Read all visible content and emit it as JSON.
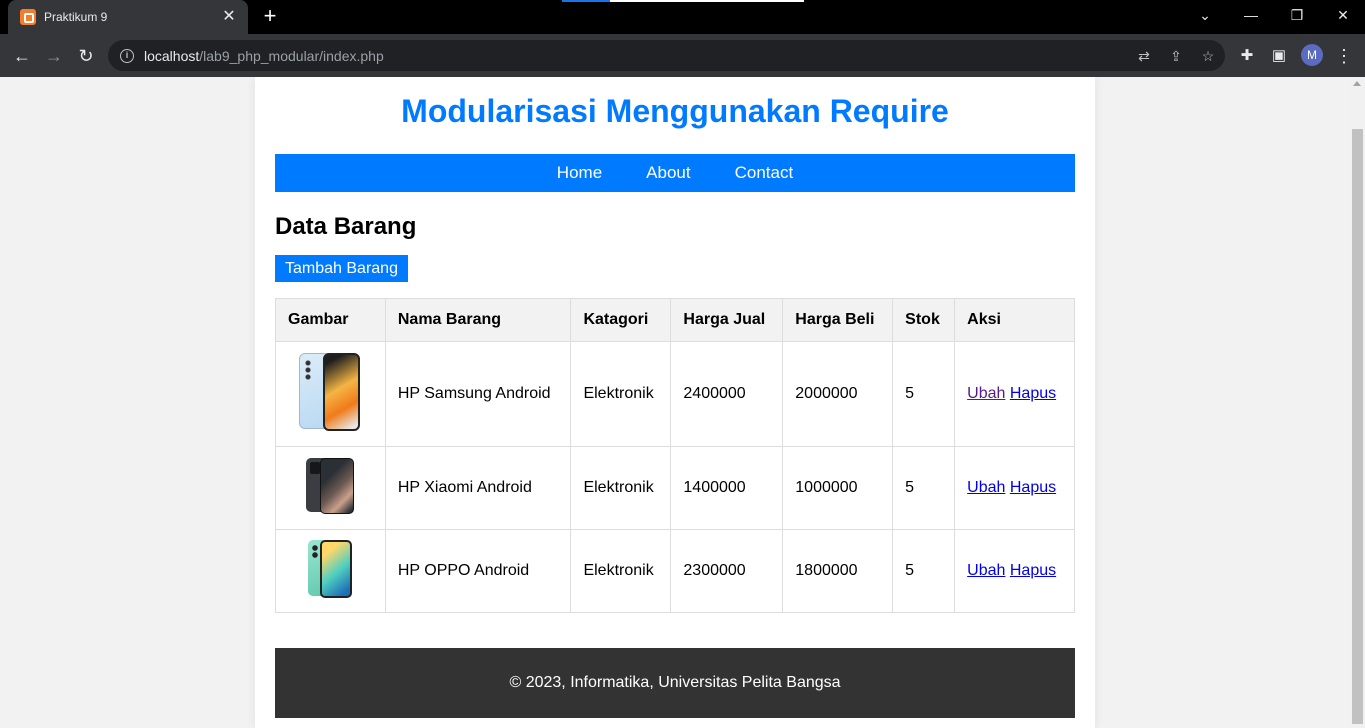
{
  "browser": {
    "tab_title": "Praktikum 9",
    "url_host": "localhost",
    "url_path": "/lab9_php_modular/index.php",
    "profile_initial": "M"
  },
  "page": {
    "title": "Modularisasi Menggunakan Require",
    "nav": [
      "Home",
      "About",
      "Contact"
    ],
    "section_title": "Data Barang",
    "add_button": "Tambah Barang",
    "table": {
      "headers": [
        "Gambar",
        "Nama Barang",
        "Katagori",
        "Harga Jual",
        "Harga Beli",
        "Stok",
        "Aksi"
      ],
      "rows": [
        {
          "image": "samsung-phone-image",
          "nama": "HP Samsung Android",
          "kategori": "Elektronik",
          "harga_jual": "2400000",
          "harga_beli": "2000000",
          "stok": "5",
          "ubah": "Ubah",
          "hapus": "Hapus"
        },
        {
          "image": "xiaomi-phone-image",
          "nama": "HP Xiaomi Android",
          "kategori": "Elektronik",
          "harga_jual": "1400000",
          "harga_beli": "1000000",
          "stok": "5",
          "ubah": "Ubah",
          "hapus": "Hapus"
        },
        {
          "image": "oppo-phone-image",
          "nama": "HP OPPO Android",
          "kategori": "Elektronik",
          "harga_jual": "2300000",
          "harga_beli": "1800000",
          "stok": "5",
          "ubah": "Ubah",
          "hapus": "Hapus"
        }
      ]
    },
    "footer": "© 2023, Informatika, Universitas Pelita Bangsa"
  },
  "colors": {
    "accent": "#007bff",
    "footer_bg": "#333333",
    "link": "#0000ee",
    "visited_link": "#551a8b"
  }
}
